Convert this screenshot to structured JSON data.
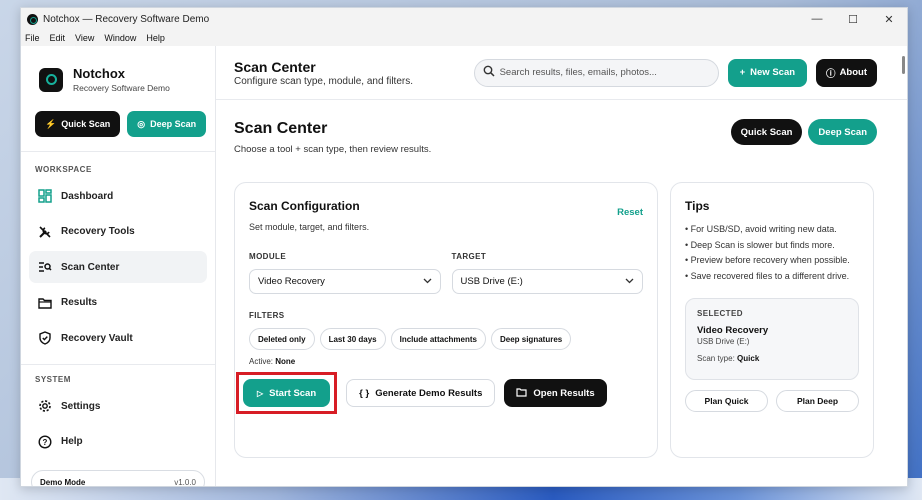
{
  "window": {
    "title": "Notchox — Recovery Software Demo",
    "controls": {
      "minimize": "—",
      "maximize": "☐",
      "close": "✕"
    }
  },
  "menu": [
    "File",
    "Edit",
    "View",
    "Window",
    "Help"
  ],
  "sidebar": {
    "brand_name": "Notchox",
    "brand_sub": "Recovery Software Demo",
    "quick_scan": "Quick Scan",
    "deep_scan": "Deep Scan",
    "workspace_label": "WORKSPACE",
    "workspace_items": [
      {
        "label": "Dashboard",
        "icon": "dashboard-icon"
      },
      {
        "label": "Recovery Tools",
        "icon": "tools-icon"
      },
      {
        "label": "Scan Center",
        "icon": "scan-icon",
        "active": true
      },
      {
        "label": "Results",
        "icon": "folder-icon"
      },
      {
        "label": "Recovery Vault",
        "icon": "shield-icon"
      }
    ],
    "system_label": "SYSTEM",
    "system_items": [
      {
        "label": "Settings",
        "icon": "gear-icon"
      },
      {
        "label": "Help",
        "icon": "help-icon"
      }
    ],
    "demo_mode": "Demo Mode",
    "version": "v1.0.0"
  },
  "topbar": {
    "title": "Scan Center",
    "subtitle": "Configure scan type, module, and filters.",
    "search_placeholder": "Search results, files, emails, photos...",
    "new_scan": "New Scan",
    "about": "About"
  },
  "content": {
    "title": "Scan Center",
    "subtitle": "Choose a tool + scan type, then review results.",
    "quick_scan": "Quick Scan",
    "deep_scan": "Deep Scan"
  },
  "config": {
    "title": "Scan Configuration",
    "subtitle": "Set module, target, and filters.",
    "reset": "Reset",
    "module_label": "MODULE",
    "module_value": "Video Recovery",
    "target_label": "TARGET",
    "target_value": "USB Drive (E:)",
    "filters_label": "FILTERS",
    "filters": [
      "Deleted only",
      "Last 30 days",
      "Include attachments",
      "Deep signatures"
    ],
    "active_label": "Active:",
    "active_value": "None",
    "start_scan": "Start Scan",
    "generate_demo": "Generate Demo Results",
    "open_results": "Open Results"
  },
  "tips": {
    "title": "Tips",
    "items": [
      "• For USB/SD, avoid writing new data.",
      "• Deep Scan is slower but finds more.",
      "• Preview before recovery when possible.",
      "• Save recovered files to a different drive."
    ],
    "selected_label": "SELECTED",
    "selected_module": "Video Recovery",
    "selected_target": "USB Drive (E:)",
    "scan_type_label": "Scan type:",
    "scan_type_value": "Quick",
    "plan_quick": "Plan Quick",
    "plan_deep": "Plan Deep"
  },
  "colors": {
    "accent": "#13a08c",
    "dark": "#111111",
    "highlight": "#d71d25"
  }
}
